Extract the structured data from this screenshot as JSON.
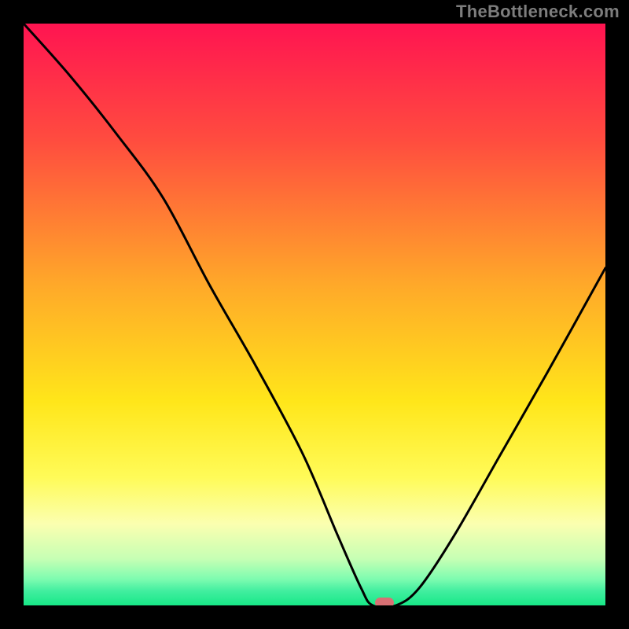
{
  "watermark": "TheBottleneck.com",
  "chart_data": {
    "type": "line",
    "title": "",
    "xlabel": "",
    "ylabel": "",
    "xlim": [
      0,
      100
    ],
    "ylim": [
      0,
      100
    ],
    "x": [
      0,
      8,
      16,
      24,
      32,
      40,
      48,
      54,
      58,
      60,
      64,
      68,
      74,
      82,
      90,
      100
    ],
    "values": [
      100,
      91,
      81,
      70,
      55,
      41,
      26,
      12,
      3,
      0,
      0,
      3,
      12,
      26,
      40,
      58
    ],
    "marker": {
      "x": 62,
      "y": 0
    },
    "background_gradient_stops": [
      {
        "pos": 0.0,
        "color": "#ff1451"
      },
      {
        "pos": 0.2,
        "color": "#ff4c3f"
      },
      {
        "pos": 0.45,
        "color": "#ffa929"
      },
      {
        "pos": 0.65,
        "color": "#ffe61a"
      },
      {
        "pos": 0.78,
        "color": "#fffb58"
      },
      {
        "pos": 0.86,
        "color": "#fbffb0"
      },
      {
        "pos": 0.92,
        "color": "#c6ffb4"
      },
      {
        "pos": 0.955,
        "color": "#7dfcb0"
      },
      {
        "pos": 0.975,
        "color": "#42eea0"
      },
      {
        "pos": 1.0,
        "color": "#17e887"
      }
    ]
  }
}
